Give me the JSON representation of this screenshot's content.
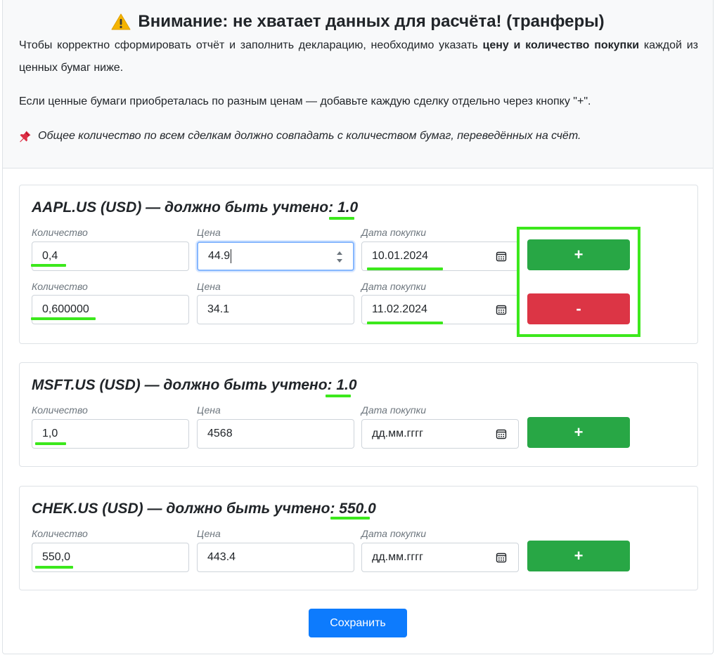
{
  "alert": {
    "icon": "warning-icon",
    "title": "Внимание: не хватает данных для расчёта! (транферы)",
    "p1_before": "Чтобы корректно сформировать отчёт и заполнить декларацию, необходимо указать ",
    "p1_bold": "цену и количество покупки",
    "p1_after": " каждой из ценных бумаг ниже.",
    "p2": "Если ценные бумаги приобреталась по разным ценам — добавьте каждую сделку отдельно через кнопку \"+\".",
    "p3_icon": "pushpin-icon",
    "p3": "Общее количество по всем сделкам должно совпадать с количеством бумаг, переведённых на счёт."
  },
  "labels": {
    "quantity": "Количество",
    "price": "Цена",
    "date": "Дата покупки"
  },
  "date_placeholder": "дд.мм.гггг",
  "cards": [
    {
      "title_prefix": "AAPL.US (USD) — должно быть учтено: ",
      "title_required": "1.0",
      "rows": [
        {
          "quantity": "0,4",
          "price": "44.9",
          "date": "10.01.2024",
          "button": "+"
        },
        {
          "quantity": "0,600000",
          "price": "34.1",
          "date": "11.02.2024",
          "button": "-"
        }
      ]
    },
    {
      "title_prefix": "MSFT.US (USD) — должно быть учтено: ",
      "title_required": "1.0",
      "rows": [
        {
          "quantity": "1,0",
          "price": "4568",
          "date": "",
          "button": "+"
        }
      ]
    },
    {
      "title_prefix": "CHEK.US (USD) — должно быть учтено: ",
      "title_required": "550.0",
      "rows": [
        {
          "quantity": "550,0",
          "price": "443.4",
          "date": "",
          "button": "+"
        }
      ]
    }
  ],
  "save_label": "Сохранить",
  "colors": {
    "highlight": "#3ce81c",
    "plus_button": "#28a745",
    "minus_button": "#dc3545",
    "save_button": "#0d7bfd"
  }
}
